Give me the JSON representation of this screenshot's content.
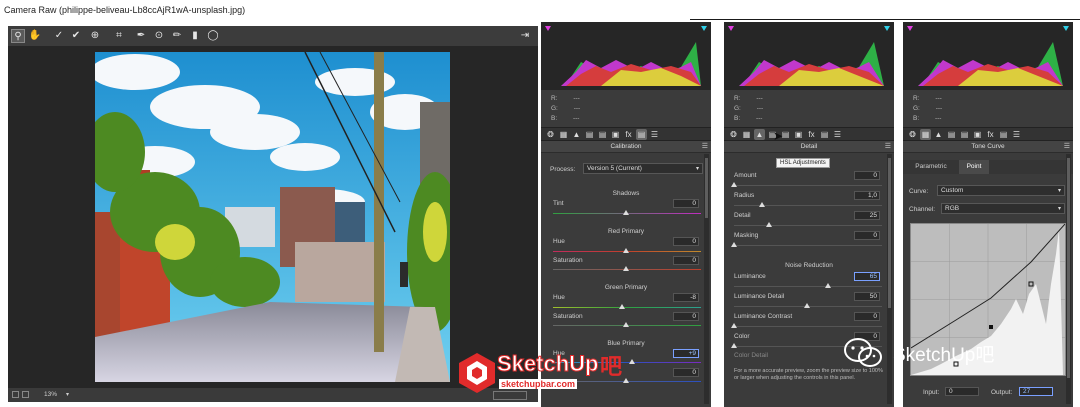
{
  "window": {
    "title": "Camera Raw (philippe-beliveau-Lb8ccAjR1wA-unsplash.jpg)"
  },
  "toolbar": {
    "tools": [
      "zoom-tool",
      "hand-tool",
      "white-balance-tool",
      "color-sampler-tool",
      "targeted-adjustment-tool",
      "crop-tool",
      "spot-removal-tool",
      "red-eye-tool",
      "adjustment-brush-tool",
      "graduated-filter-tool",
      "radial-filter-tool"
    ],
    "export_icon": "open-preferences-icon"
  },
  "status": {
    "zoom": "13%"
  },
  "histogram_readout": {
    "r_label": "R:",
    "g_label": "G:",
    "b_label": "B:",
    "r": "---",
    "g": "---",
    "b": "---"
  },
  "calibration": {
    "title": "Calibration",
    "process_label": "Process:",
    "process_value": "Version 5 (Current)",
    "shadows_title": "Shadows",
    "tint_label": "Tint",
    "tint_value": "0",
    "red_primary_title": "Red Primary",
    "red_hue_label": "Hue",
    "red_hue_value": "0",
    "red_sat_label": "Saturation",
    "red_sat_value": "0",
    "green_primary_title": "Green Primary",
    "green_hue_label": "Hue",
    "green_hue_value": "-8",
    "green_sat_label": "Saturation",
    "green_sat_value": "0",
    "blue_primary_title": "Blue Primary",
    "blue_hue_label": "Hue",
    "blue_hue_value": "+9",
    "blue_sat_value": "0"
  },
  "detail": {
    "title": "Detail",
    "tooltip": "HSL Adjustments",
    "amount_label": "Amount",
    "amount_value": "0",
    "radius_label": "Radius",
    "radius_value": "1,0",
    "detail_label": "Detail",
    "detail_value": "25",
    "masking_label": "Masking",
    "masking_value": "0",
    "noise_title": "Noise Reduction",
    "luminance_label": "Luminance",
    "luminance_value": "65",
    "lum_detail_label": "Luminance Detail",
    "lum_detail_value": "50",
    "lum_contrast_label": "Luminance Contrast",
    "lum_contrast_value": "0",
    "color_label": "Color",
    "color_value": "0",
    "color_detail_label": "Color Detail",
    "note": "For a more accurate preview, zoom the preview size to 100% or larger when adjusting the controls in this panel."
  },
  "tone_curve": {
    "title": "Tone Curve",
    "tab_parametric": "Parametric",
    "tab_point": "Point",
    "curve_label": "Curve:",
    "curve_value": "Custom",
    "channel_label": "Channel:",
    "channel_value": "RGB",
    "input_label": "Input:",
    "input_value": "0",
    "output_label": "Output:",
    "output_value": "27"
  },
  "watermark": {
    "brand": "SketchUp",
    "brand_suffix": "吧",
    "brand_url": "sketchupbar.com",
    "wechat_text": "SketchUp吧"
  },
  "colors": {
    "panel_bg": "#3b3b3b",
    "highlight": "#7aa0ff",
    "sky": "#3aa7d8",
    "brick": "#c0452b",
    "watermark_red": "#e12b2b"
  }
}
